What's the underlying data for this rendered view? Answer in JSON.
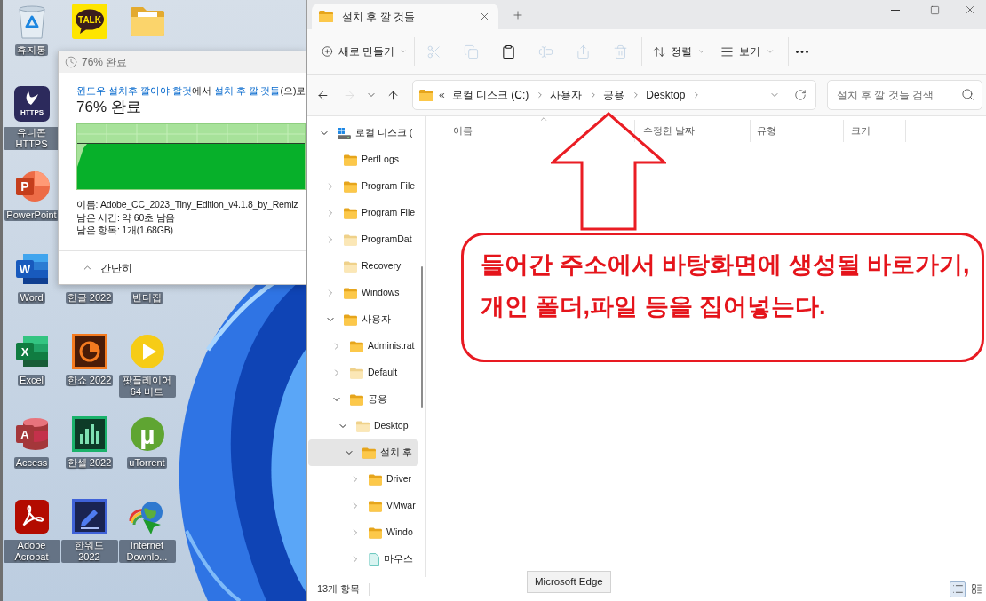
{
  "desktop": {
    "icon_rows": [
      [
        {
          "kind": "recyclebin",
          "label": "휴지통"
        },
        {
          "kind": "chat",
          "glyph": "TALK"
        },
        {
          "kind": "folder"
        }
      ],
      [
        {
          "kind": "https",
          "glyph": "HTTPS",
          "label": "유니콘 HTTPS"
        }
      ],
      [
        {
          "kind": "slides",
          "glyph": "P",
          "label": "PowerPoint"
        }
      ],
      [
        {
          "kind": "doc",
          "glyph": "W",
          "label": "Word"
        },
        {
          "label": "한글 2022"
        },
        {
          "label": "반디집"
        }
      ],
      [
        {
          "kind": "sheet",
          "glyph": "X",
          "label": "Excel"
        },
        {
          "kind": "piechart",
          "label": "한쇼 2022"
        },
        {
          "kind": "play",
          "label": "팟플레이어 64 비트"
        }
      ],
      [
        {
          "kind": "database",
          "glyph": "A",
          "label": "Access"
        },
        {
          "kind": "barchart",
          "label": "한셀 2022"
        },
        {
          "kind": "torrent",
          "glyph": "µ",
          "label": "uTorrent"
        }
      ],
      [
        {
          "kind": "pdf",
          "label": "Adobe Acrobat"
        },
        {
          "kind": "pen",
          "label": "한워드 2022"
        },
        {
          "kind": "globe",
          "label": "Internet Downlo..."
        }
      ]
    ]
  },
  "copy_dialog": {
    "title": "76% 완료",
    "description": [
      {
        "kind": "link",
        "text": "윈도우 설치후 깔아야 할것"
      },
      {
        "kind": "plain",
        "text": "에서 "
      },
      {
        "kind": "link",
        "text": "설치 후 깔 것들"
      },
      {
        "kind": "plain",
        "text": "(으)로"
      }
    ],
    "progress_text": "76% 완료",
    "details": [
      "이름: Adobe_CC_2023_Tiny_Edition_v4.1.8_by_Remiz",
      "남은 시간: 약 60초 남음",
      "남은 항목: 1개(1.68GB)"
    ],
    "toggle": "간단히"
  },
  "explorer": {
    "tabs": [
      {
        "title": "설치 후 깔 것들",
        "selected": true
      }
    ],
    "toolbar": [
      [
        {
          "kind": "new",
          "label": "새로 만들기",
          "disabled": false
        }
      ],
      [
        {
          "kind": "cut",
          "disabled": true
        },
        {
          "kind": "copy",
          "disabled": true
        },
        {
          "kind": "paste",
          "disabled": false
        },
        {
          "kind": "rename",
          "disabled": true
        },
        {
          "kind": "share",
          "disabled": true
        },
        {
          "kind": "delete",
          "disabled": true
        }
      ],
      [
        {
          "kind": "sort",
          "label": "정렬",
          "disabled": false
        },
        {
          "kind": "view",
          "label": "보기",
          "disabled": false
        }
      ],
      [
        {
          "kind": "more",
          "disabled": false
        }
      ]
    ],
    "nav_buttons": [
      {
        "kind": "back",
        "disabled": false
      },
      {
        "kind": "forward",
        "disabled": true
      },
      {
        "kind": "recent",
        "disabled": false
      },
      {
        "kind": "up",
        "disabled": false
      }
    ],
    "address": {
      "overflow": "«",
      "segments": [
        "로컬 디스크 (C:)",
        "사용자",
        "공용",
        "Desktop"
      ]
    },
    "search": {
      "placeholder": "설치 후 깔 것들 검색"
    },
    "tree": [
      {
        "label": "로컬 디스크 (",
        "kind": "drive",
        "expandable": true,
        "expanded": true,
        "selected": false,
        "children": [
          {
            "label": "PerfLogs",
            "kind": "folder",
            "expandable": false,
            "expanded": false,
            "selected": false
          },
          {
            "label": "Program File",
            "kind": "folder",
            "expandable": true,
            "expanded": false,
            "selected": false
          },
          {
            "label": "Program File",
            "kind": "folder",
            "expandable": true,
            "expanded": false,
            "selected": false
          },
          {
            "label": "ProgramDat",
            "kind": "hiddenfolder",
            "expandable": true,
            "expanded": false,
            "selected": false
          },
          {
            "label": "Recovery",
            "kind": "hiddenfolder",
            "expandable": false,
            "expanded": false,
            "selected": false
          },
          {
            "label": "Windows",
            "kind": "folder",
            "expandable": true,
            "expanded": false,
            "selected": false
          },
          {
            "label": "사용자",
            "kind": "folder",
            "expandable": true,
            "expanded": true,
            "selected": false,
            "children": [
              {
                "label": "Administrat",
                "kind": "folder",
                "expandable": true,
                "expanded": false,
                "selected": false
              },
              {
                "label": "Default",
                "kind": "hiddenfolder",
                "expandable": true,
                "expanded": false,
                "selected": false
              },
              {
                "label": "공용",
                "kind": "folder",
                "expandable": true,
                "expanded": true,
                "selected": false,
                "children": [
                  {
                    "label": "Desktop",
                    "kind": "hiddenfolder",
                    "expandable": true,
                    "expanded": true,
                    "selected": false,
                    "children": [
                      {
                        "label": "설치 후",
                        "kind": "folder",
                        "expandable": true,
                        "expanded": true,
                        "selected": true,
                        "children": [
                          {
                            "label": "Driver",
                            "kind": "folder",
                            "expandable": true,
                            "expanded": false,
                            "selected": false
                          },
                          {
                            "label": "VMwar",
                            "kind": "folder",
                            "expandable": true,
                            "expanded": false,
                            "selected": false
                          },
                          {
                            "label": "Windo",
                            "kind": "folder",
                            "expandable": true,
                            "expanded": false,
                            "selected": false
                          },
                          {
                            "label": "마우스",
                            "kind": "file",
                            "expandable": true,
                            "expanded": false,
                            "selected": false
                          }
                        ]
                      }
                    ]
                  }
                ]
              }
            ]
          }
        ]
      }
    ],
    "columns": [
      {
        "label": "이름",
        "sorted": true
      },
      {
        "label": "수정한 날짜",
        "sorted": false
      },
      {
        "label": "유형",
        "sorted": false
      },
      {
        "label": "크기",
        "sorted": false
      }
    ],
    "status_bar": {
      "count": "13개 항목",
      "views": [
        {
          "kind": "details",
          "selected": true
        },
        {
          "kind": "tiles",
          "selected": false
        }
      ]
    },
    "tooltip": {
      "text": "Microsoft Edge"
    }
  },
  "annotation": {
    "lines": [
      "들어간 주소에서 바탕화면에 생성될 바로가기,",
      "개인 폴더,파일 등을 집어넣는다."
    ]
  }
}
